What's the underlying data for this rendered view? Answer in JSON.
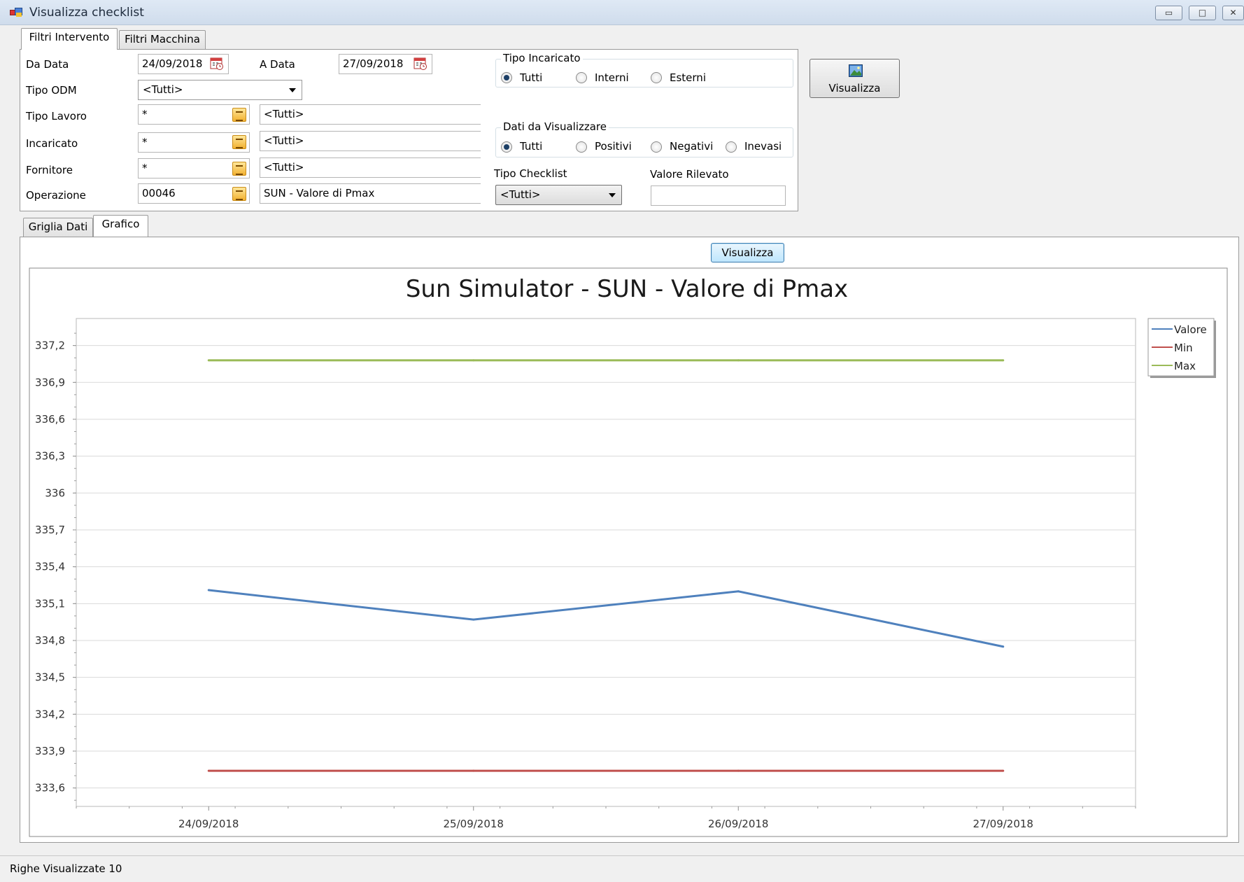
{
  "window": {
    "title": "Visualizza checklist",
    "buttons": {
      "minimize": "▭",
      "maximize": "□",
      "close": "✕"
    }
  },
  "filter_tabs": [
    {
      "label": "Filtri Intervento",
      "active": true
    },
    {
      "label": "Filtri Macchina",
      "active": false
    }
  ],
  "filters": {
    "da_data_label": "Da Data",
    "da_data_value": "24/09/2018",
    "a_data_label": "A Data",
    "a_data_value": "27/09/2018",
    "tipo_odm_label": "Tipo ODM",
    "tipo_odm_value": "<Tutti>",
    "tipo_lavoro_label": "Tipo Lavoro",
    "tipo_lavoro_code": "*",
    "tipo_lavoro_desc": "<Tutti>",
    "incaricato_label": "Incaricato",
    "incaricato_code": "*",
    "incaricato_desc": "<Tutti>",
    "fornitore_label": "Fornitore",
    "fornitore_code": "*",
    "fornitore_desc": "<Tutti>",
    "operazione_label": "Operazione",
    "operazione_code": "00046",
    "operazione_desc": "SUN - Valore di Pmax"
  },
  "tipo_incaricato": {
    "legend": "Tipo Incaricato",
    "options": [
      "Tutti",
      "Interni",
      "Esterni"
    ],
    "selected": "Tutti"
  },
  "dati_visualizzare": {
    "legend": "Dati da Visualizzare",
    "options": [
      "Tutti",
      "Positivi",
      "Negativi",
      "Inevasi"
    ],
    "selected": "Tutti"
  },
  "tipo_checklist": {
    "label": "Tipo Checklist",
    "value": "<Tutti>"
  },
  "valore_rilevato": {
    "label": "Valore Rilevato",
    "value": ""
  },
  "visualizza_main_label": "Visualizza",
  "result_tabs": [
    {
      "label": "Griglia Dati",
      "active": false
    },
    {
      "label": "Grafico",
      "active": true
    }
  ],
  "chart_visualizza_label": "Visualizza",
  "chart_data": {
    "type": "line",
    "title": "Sun Simulator - SUN - Valore di Pmax",
    "xlabel": "",
    "ylabel": "",
    "categories": [
      "24/09/2018",
      "25/09/2018",
      "26/09/2018",
      "27/09/2018"
    ],
    "y_ticks": [
      "337,2",
      "336,9",
      "336,6",
      "336,3",
      "336",
      "335,7",
      "335,4",
      "335,1",
      "334,8",
      "334,5",
      "334,2",
      "333,9",
      "333,6"
    ],
    "ylim": [
      333.45,
      337.42
    ],
    "grid": true,
    "legend_position": "top-right",
    "series": [
      {
        "name": "Valore",
        "color": "#4f81bd",
        "values": [
          335.21,
          334.97,
          335.2,
          334.75
        ]
      },
      {
        "name": "Min",
        "color": "#c0504d",
        "values": [
          333.74,
          333.74,
          333.74,
          333.74
        ]
      },
      {
        "name": "Max",
        "color": "#9bbb59",
        "values": [
          337.08,
          337.08,
          337.08,
          337.08
        ]
      }
    ]
  },
  "status": {
    "text": "Righe Visualizzate 10"
  }
}
